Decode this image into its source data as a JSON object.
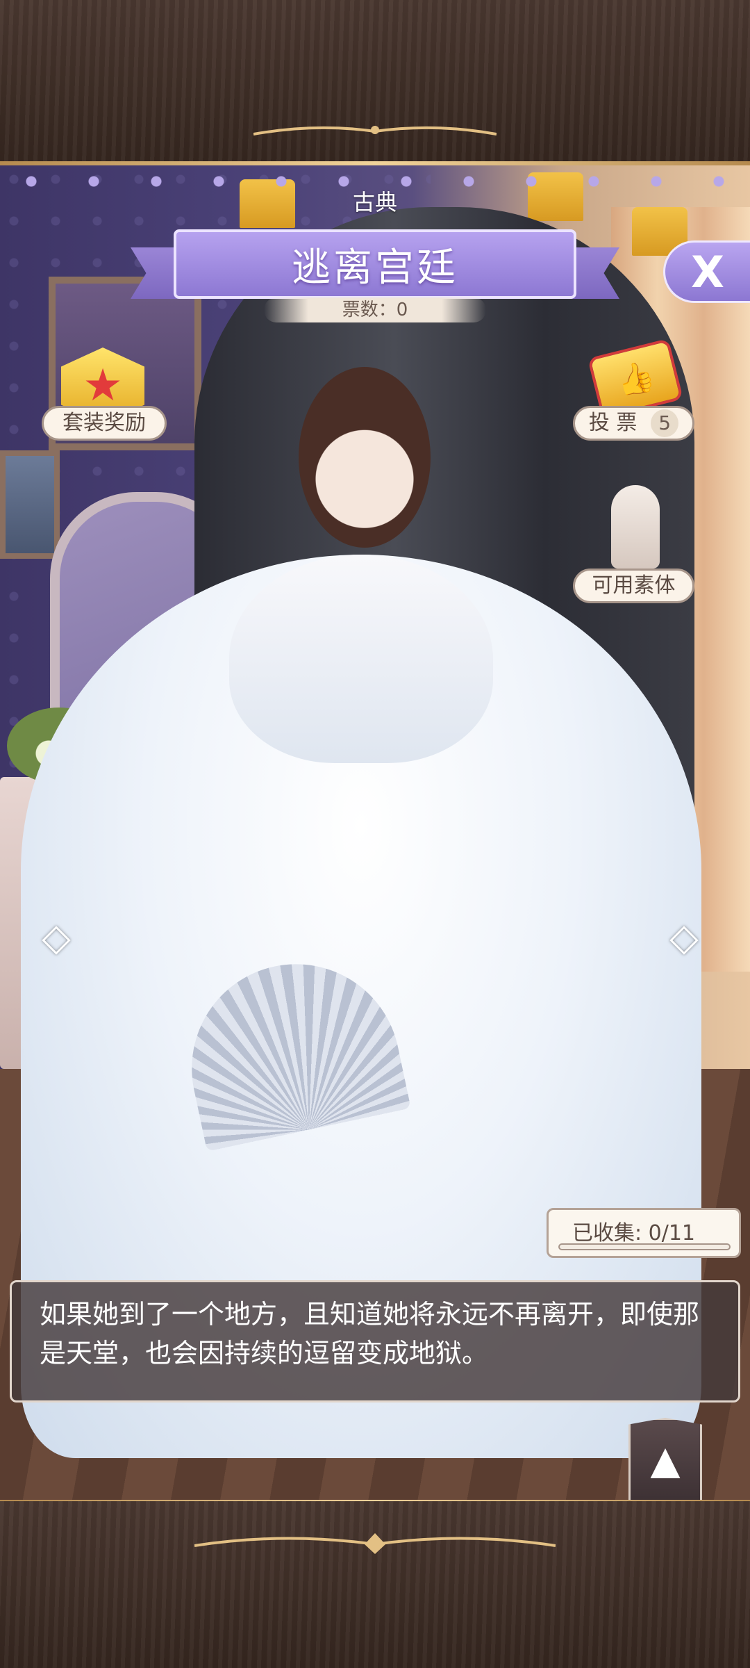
{
  "outfit": {
    "category": "古典",
    "title": "逃离宫廷",
    "votes_label": "票数：0"
  },
  "left_panel": {
    "reward_label": "套装奖励",
    "reward_icon": "star-badge-icon"
  },
  "right_panel": {
    "vote_label": "投 票",
    "vote_count": "5",
    "vote_icon": "ticket-icon",
    "model_label": "可用素体",
    "model_icon": "mannequin-icon"
  },
  "collection": {
    "label": "已收集:  0/11",
    "collected": 0,
    "total": 11
  },
  "description": "如果她到了一个地方，且知道她将永远不再离开，即使那是天堂，也会因持续的逗留变成地狱。",
  "controls": {
    "close_icon": "X",
    "left_arrow": "◇",
    "right_arrow": "◇",
    "expand_icon": "▲"
  },
  "colors": {
    "banner": "#a692e4",
    "frame": "#3f2f28",
    "gold": "#e3c084"
  }
}
